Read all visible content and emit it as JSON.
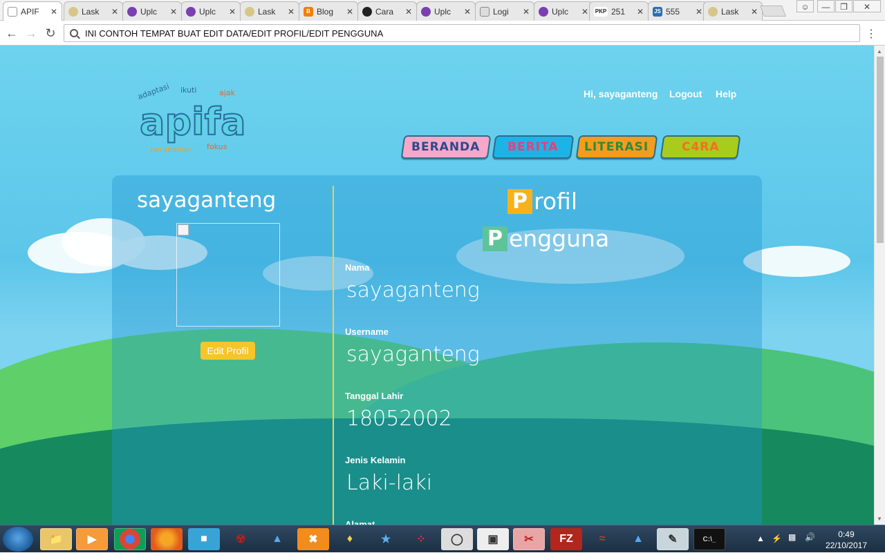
{
  "browser": {
    "tabs": [
      {
        "label": "APIF",
        "active": true
      },
      {
        "label": "Lask"
      },
      {
        "label": "Uplc"
      },
      {
        "label": "Uplc"
      },
      {
        "label": "Lask"
      },
      {
        "label": "Blog"
      },
      {
        "label": "Cara"
      },
      {
        "label": "Uplc"
      },
      {
        "label": "Logi"
      },
      {
        "label": "Uplc"
      },
      {
        "label": "251"
      },
      {
        "label": "555"
      },
      {
        "label": "Lask"
      }
    ],
    "address": "INI CONTOH TEMPAT BUAT EDIT DATA/EDIT PROFIL/EDIT PENGGUNA"
  },
  "header": {
    "logo_text": "apifa",
    "greeting": "Hi, sayaganteng",
    "logout": "Logout",
    "help": "Help"
  },
  "nav": {
    "beranda": "BERANDA",
    "berita": "BERITA",
    "literasi": "LITERASI",
    "cyra": "C4RA"
  },
  "profile": {
    "username_heading": "sayaganteng",
    "edit_button": "Edit Profil",
    "title_line1_cap": "P",
    "title_line1_rest": "rofil",
    "title_line2_cap": "P",
    "title_line2_rest": "engguna",
    "fields": [
      {
        "label": "Nama",
        "value": "sayaganteng"
      },
      {
        "label": "Username",
        "value": "sayaganteng"
      },
      {
        "label": "Tanggal Lahir",
        "value": "18052002"
      },
      {
        "label": "Jenis Kelamin",
        "value": "Laki-laki"
      },
      {
        "label": "Alamat",
        "value": ""
      }
    ]
  },
  "taskbar": {
    "time": "0:49",
    "date": "22/10/2017"
  },
  "colors": {
    "sky": "#5cc6ea",
    "panel": "#2096d2",
    "divider": "#e7d35a",
    "button": "#f6c52a",
    "cap1": "#f6b21b",
    "cap2": "#5fc39a"
  }
}
